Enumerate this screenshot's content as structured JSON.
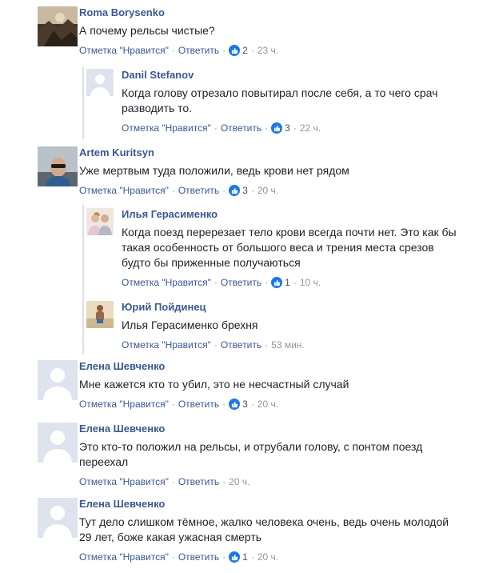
{
  "labels": {
    "like": "Отметка \"Нравится\"",
    "reply": "Ответить",
    "sep": "·"
  },
  "colors": {
    "link": "#385898",
    "like_badge": "#1877f2",
    "meta": "#90949c"
  },
  "comments": [
    {
      "author": "Roma Borysenko",
      "text": "А почему рельсы чистые?",
      "likes": "2",
      "time": "23 ч.",
      "avatar": "landscape-photo"
    },
    {
      "author": "Danil Stefanov",
      "text": "Когда голову отрезало повытирал после себя, а то чего срач разводить то.",
      "likes": "3",
      "time": "22 ч.",
      "avatar": "default-avatar"
    },
    {
      "author": "Artem Kuritsyn",
      "text": "Уже мертвым туда положили, ведь крови нет рядом",
      "likes": "3",
      "time": "20 ч.",
      "avatar": "man-sunglasses-photo"
    },
    {
      "author": "Илья Герасименко",
      "text": "Когда поезд перерезает тело крови всегда почти нет. Это как бы такая особенность от большого веса и трения места срезов будто бы приженные получаються",
      "likes": "1",
      "time": "10 ч.",
      "avatar": "two-people-photo"
    },
    {
      "author": "Юрий Пойдинец",
      "text": "Илья Герасименко брехня",
      "likes": "",
      "time": "53 мин.",
      "avatar": "beach-person-photo"
    },
    {
      "author": "Елена Шевченко",
      "text": "Мне кажется кто то убил, это не несчастный случай",
      "likes": "3",
      "time": "20 ч.",
      "avatar": "default-avatar"
    },
    {
      "author": "Елена Шевченко",
      "text": "Это кто-то положил на рельсы, и отрубали голову, с понтом поезд переехал",
      "likes": "",
      "time": "20 ч.",
      "avatar": "default-avatar"
    },
    {
      "author": "Елена Шевченко",
      "text": "Тут дело слишком тёмное, жалко человека очень, ведь очень молодой 29 лет, боже какая ужасная смерть",
      "likes": "1",
      "time": "20 ч.",
      "avatar": "default-avatar"
    }
  ]
}
